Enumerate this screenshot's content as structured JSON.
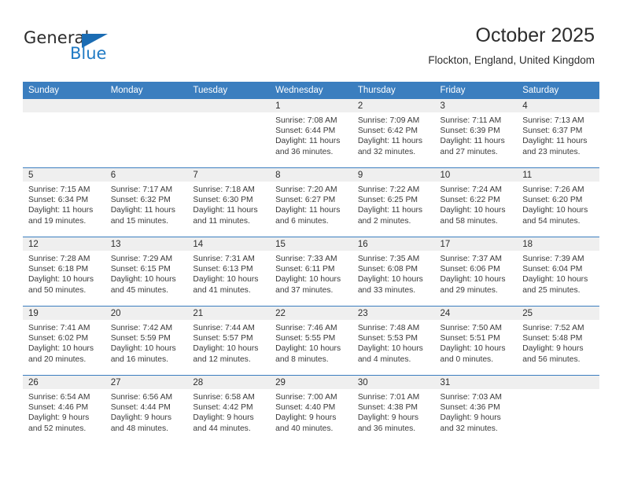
{
  "brand": {
    "name_part1": "General",
    "name_part2": "Blue",
    "accent_color": "#1b6cb3"
  },
  "header": {
    "title": "October 2025",
    "subtitle": "Flockton, England, United Kingdom"
  },
  "calendar": {
    "header_background": "#3b7ebf",
    "date_band_background": "#efefef",
    "weekdays": [
      "Sunday",
      "Monday",
      "Tuesday",
      "Wednesday",
      "Thursday",
      "Friday",
      "Saturday"
    ],
    "weeks": [
      [
        {
          "date": "",
          "empty": true
        },
        {
          "date": "",
          "empty": true
        },
        {
          "date": "",
          "empty": true
        },
        {
          "date": "1",
          "sunrise": "Sunrise: 7:08 AM",
          "sunset": "Sunset: 6:44 PM",
          "daylight": "Daylight: 11 hours and 36 minutes."
        },
        {
          "date": "2",
          "sunrise": "Sunrise: 7:09 AM",
          "sunset": "Sunset: 6:42 PM",
          "daylight": "Daylight: 11 hours and 32 minutes."
        },
        {
          "date": "3",
          "sunrise": "Sunrise: 7:11 AM",
          "sunset": "Sunset: 6:39 PM",
          "daylight": "Daylight: 11 hours and 27 minutes."
        },
        {
          "date": "4",
          "sunrise": "Sunrise: 7:13 AM",
          "sunset": "Sunset: 6:37 PM",
          "daylight": "Daylight: 11 hours and 23 minutes."
        }
      ],
      [
        {
          "date": "5",
          "sunrise": "Sunrise: 7:15 AM",
          "sunset": "Sunset: 6:34 PM",
          "daylight": "Daylight: 11 hours and 19 minutes."
        },
        {
          "date": "6",
          "sunrise": "Sunrise: 7:17 AM",
          "sunset": "Sunset: 6:32 PM",
          "daylight": "Daylight: 11 hours and 15 minutes."
        },
        {
          "date": "7",
          "sunrise": "Sunrise: 7:18 AM",
          "sunset": "Sunset: 6:30 PM",
          "daylight": "Daylight: 11 hours and 11 minutes."
        },
        {
          "date": "8",
          "sunrise": "Sunrise: 7:20 AM",
          "sunset": "Sunset: 6:27 PM",
          "daylight": "Daylight: 11 hours and 6 minutes."
        },
        {
          "date": "9",
          "sunrise": "Sunrise: 7:22 AM",
          "sunset": "Sunset: 6:25 PM",
          "daylight": "Daylight: 11 hours and 2 minutes."
        },
        {
          "date": "10",
          "sunrise": "Sunrise: 7:24 AM",
          "sunset": "Sunset: 6:22 PM",
          "daylight": "Daylight: 10 hours and 58 minutes."
        },
        {
          "date": "11",
          "sunrise": "Sunrise: 7:26 AM",
          "sunset": "Sunset: 6:20 PM",
          "daylight": "Daylight: 10 hours and 54 minutes."
        }
      ],
      [
        {
          "date": "12",
          "sunrise": "Sunrise: 7:28 AM",
          "sunset": "Sunset: 6:18 PM",
          "daylight": "Daylight: 10 hours and 50 minutes."
        },
        {
          "date": "13",
          "sunrise": "Sunrise: 7:29 AM",
          "sunset": "Sunset: 6:15 PM",
          "daylight": "Daylight: 10 hours and 45 minutes."
        },
        {
          "date": "14",
          "sunrise": "Sunrise: 7:31 AM",
          "sunset": "Sunset: 6:13 PM",
          "daylight": "Daylight: 10 hours and 41 minutes."
        },
        {
          "date": "15",
          "sunrise": "Sunrise: 7:33 AM",
          "sunset": "Sunset: 6:11 PM",
          "daylight": "Daylight: 10 hours and 37 minutes."
        },
        {
          "date": "16",
          "sunrise": "Sunrise: 7:35 AM",
          "sunset": "Sunset: 6:08 PM",
          "daylight": "Daylight: 10 hours and 33 minutes."
        },
        {
          "date": "17",
          "sunrise": "Sunrise: 7:37 AM",
          "sunset": "Sunset: 6:06 PM",
          "daylight": "Daylight: 10 hours and 29 minutes."
        },
        {
          "date": "18",
          "sunrise": "Sunrise: 7:39 AM",
          "sunset": "Sunset: 6:04 PM",
          "daylight": "Daylight: 10 hours and 25 minutes."
        }
      ],
      [
        {
          "date": "19",
          "sunrise": "Sunrise: 7:41 AM",
          "sunset": "Sunset: 6:02 PM",
          "daylight": "Daylight: 10 hours and 20 minutes."
        },
        {
          "date": "20",
          "sunrise": "Sunrise: 7:42 AM",
          "sunset": "Sunset: 5:59 PM",
          "daylight": "Daylight: 10 hours and 16 minutes."
        },
        {
          "date": "21",
          "sunrise": "Sunrise: 7:44 AM",
          "sunset": "Sunset: 5:57 PM",
          "daylight": "Daylight: 10 hours and 12 minutes."
        },
        {
          "date": "22",
          "sunrise": "Sunrise: 7:46 AM",
          "sunset": "Sunset: 5:55 PM",
          "daylight": "Daylight: 10 hours and 8 minutes."
        },
        {
          "date": "23",
          "sunrise": "Sunrise: 7:48 AM",
          "sunset": "Sunset: 5:53 PM",
          "daylight": "Daylight: 10 hours and 4 minutes."
        },
        {
          "date": "24",
          "sunrise": "Sunrise: 7:50 AM",
          "sunset": "Sunset: 5:51 PM",
          "daylight": "Daylight: 10 hours and 0 minutes."
        },
        {
          "date": "25",
          "sunrise": "Sunrise: 7:52 AM",
          "sunset": "Sunset: 5:48 PM",
          "daylight": "Daylight: 9 hours and 56 minutes."
        }
      ],
      [
        {
          "date": "26",
          "sunrise": "Sunrise: 6:54 AM",
          "sunset": "Sunset: 4:46 PM",
          "daylight": "Daylight: 9 hours and 52 minutes."
        },
        {
          "date": "27",
          "sunrise": "Sunrise: 6:56 AM",
          "sunset": "Sunset: 4:44 PM",
          "daylight": "Daylight: 9 hours and 48 minutes."
        },
        {
          "date": "28",
          "sunrise": "Sunrise: 6:58 AM",
          "sunset": "Sunset: 4:42 PM",
          "daylight": "Daylight: 9 hours and 44 minutes."
        },
        {
          "date": "29",
          "sunrise": "Sunrise: 7:00 AM",
          "sunset": "Sunset: 4:40 PM",
          "daylight": "Daylight: 9 hours and 40 minutes."
        },
        {
          "date": "30",
          "sunrise": "Sunrise: 7:01 AM",
          "sunset": "Sunset: 4:38 PM",
          "daylight": "Daylight: 9 hours and 36 minutes."
        },
        {
          "date": "31",
          "sunrise": "Sunrise: 7:03 AM",
          "sunset": "Sunset: 4:36 PM",
          "daylight": "Daylight: 9 hours and 32 minutes."
        },
        {
          "date": "",
          "empty": true
        }
      ]
    ]
  }
}
